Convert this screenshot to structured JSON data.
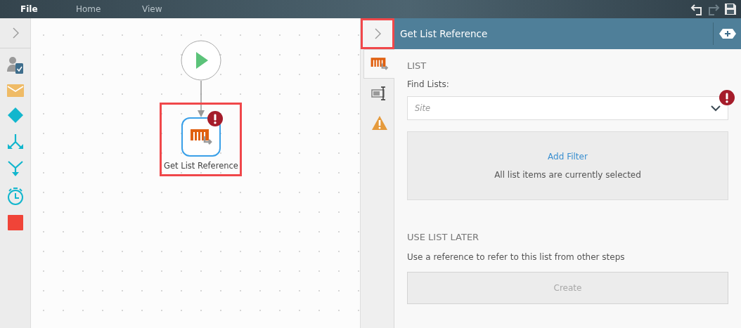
{
  "menu": [
    {
      "label": "File",
      "selected": true
    },
    {
      "label": "Home",
      "selected": false
    },
    {
      "label": "View",
      "selected": false
    }
  ],
  "toolbox": [
    {
      "kind": "task"
    },
    {
      "kind": "email"
    },
    {
      "kind": "decision"
    },
    {
      "kind": "split"
    },
    {
      "kind": "merge"
    },
    {
      "kind": "timer"
    },
    {
      "kind": "end"
    }
  ],
  "step": {
    "label": "Get List Reference",
    "error": true,
    "highlighted": true
  },
  "panel": {
    "collapse_highlighted": true,
    "title": "Get List Reference",
    "tabs": [
      {
        "kind": "list",
        "selected": true
      },
      {
        "kind": "field",
        "selected": false
      },
      {
        "kind": "warning",
        "selected": false
      }
    ],
    "section": "LIST",
    "find_label": "Find Lists:",
    "site": {
      "placeholder": "Site",
      "error": true
    },
    "add_filter": "Add Filter",
    "filter_status": "All list items are currently selected",
    "later_heading": "USE LIST LATER",
    "later_text": "Use a reference to refer to this list from other steps",
    "create": {
      "label": "Create",
      "disabled": true
    }
  }
}
